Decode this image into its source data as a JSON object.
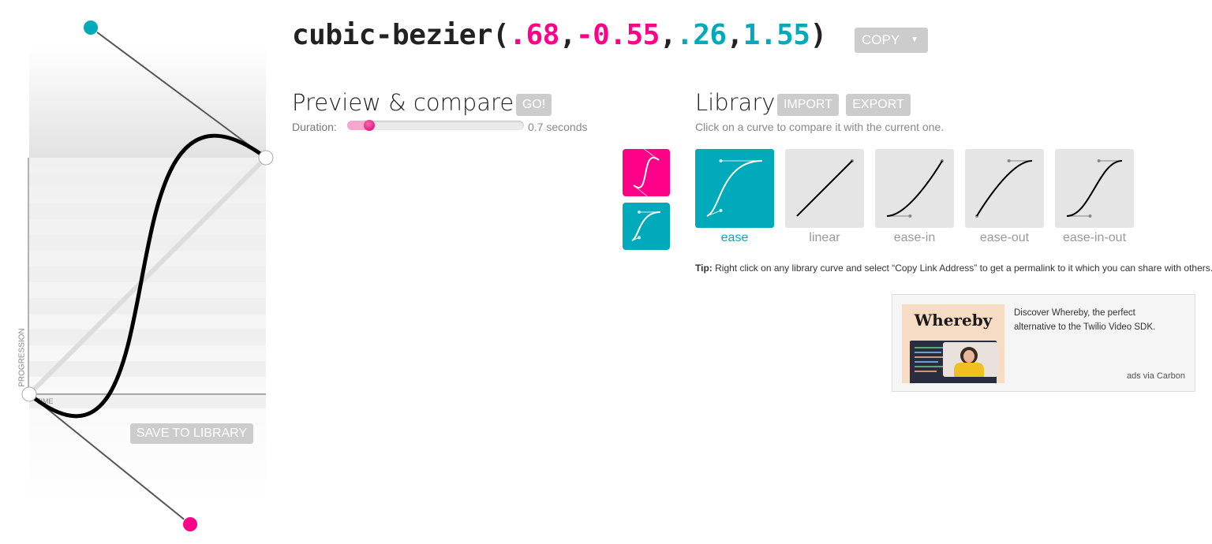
{
  "formula": {
    "prefix": "cubic-bezier(",
    "x1": ".68",
    "y1": "-0.55",
    "x2": ".26",
    "y2": "1.55",
    "suffix": ")",
    "sep": ","
  },
  "curve": {
    "x1": 0.68,
    "y1": -0.55,
    "x2": 0.26,
    "y2": 1.55
  },
  "copy_button": "COPY",
  "preview": {
    "title": "Preview & compare",
    "go_button": "GO!",
    "duration_label": "Duration:",
    "duration_value": "0.7 seconds",
    "duration_level": 0.08
  },
  "editor": {
    "axis_progression": "PROGRESSION",
    "axis_time": "TIME",
    "save_button": "SAVE TO LIBRARY"
  },
  "library": {
    "title": "Library",
    "import_button": "IMPORT",
    "export_button": "EXPORT",
    "hint": "Click on a curve to compare it with the current one.",
    "items": [
      {
        "label": "ease",
        "selected": true,
        "p": [
          0.25,
          0.1,
          0.25,
          1.0
        ]
      },
      {
        "label": "linear",
        "selected": false,
        "p": [
          0,
          0,
          1,
          1
        ]
      },
      {
        "label": "ease-in",
        "selected": false,
        "p": [
          0.42,
          0,
          1,
          1
        ]
      },
      {
        "label": "ease-out",
        "selected": false,
        "p": [
          0,
          0,
          0.58,
          1
        ]
      },
      {
        "label": "ease-in-out",
        "selected": false,
        "p": [
          0.42,
          0,
          0.58,
          1
        ]
      }
    ]
  },
  "tip": {
    "label": "Tip:",
    "text": "Right click on any library curve and select “Copy Link Address” to get a permalink to it which you can share with others."
  },
  "ad": {
    "brand": "Whereby",
    "text": "Discover Whereby, the perfect alternative to the Twilio Video SDK.",
    "via": "ads via Carbon"
  },
  "colors": {
    "pink": "#ff0088",
    "teal": "#00aabb",
    "button": "#cccccc"
  }
}
